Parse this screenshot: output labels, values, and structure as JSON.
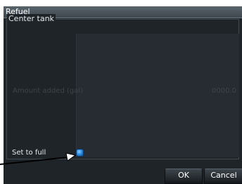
{
  "dialog": {
    "title": "Refuel",
    "group_label": "Center tank",
    "amount_label": "Amount added (gal)",
    "amount_value": "0000.0",
    "set_full_label": "Set to full",
    "set_full_checked": true
  },
  "buttons": {
    "ok_label": "OK",
    "cancel_label": "Cancel"
  },
  "colors": {
    "dialog_bg": "#1f2428",
    "accent_checkbox": "#2f8fe0",
    "callout": "#000000"
  }
}
